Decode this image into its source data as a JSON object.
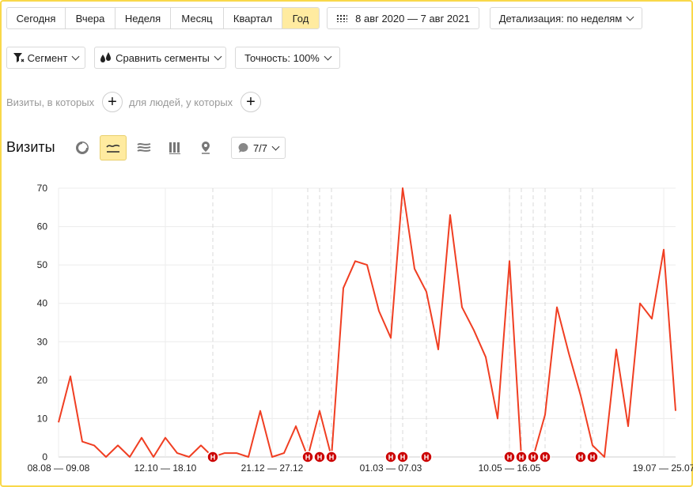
{
  "period_tabs": [
    {
      "label": "Сегодня",
      "active": false
    },
    {
      "label": "Вчера",
      "active": false
    },
    {
      "label": "Неделя",
      "active": false
    },
    {
      "label": "Месяц",
      "active": false
    },
    {
      "label": "Квартал",
      "active": false
    },
    {
      "label": "Год",
      "active": true
    }
  ],
  "date_range": "8 авг 2020 — 7 авг 2021",
  "detail_label": "Детализация: по неделям",
  "segment_label": "Сегмент",
  "compare_label": "Сравнить сегменты",
  "accuracy_label": "Точность: 100%",
  "filter": {
    "visits_label": "Визиты, в которых",
    "people_label": "для людей, у которых"
  },
  "chart_title": "Визиты",
  "annotations_label": "7/7",
  "colors": {
    "accent": "#ffeba0",
    "line": "#f03e22",
    "marker": "#cc0000",
    "frame": "#f9d84a"
  },
  "chart_data": {
    "type": "line",
    "ylim": [
      0,
      70
    ],
    "yticks": [
      0,
      10,
      20,
      30,
      40,
      50,
      60,
      70
    ],
    "xtick_labels": [
      "08.08 — 09.08",
      "12.10 — 18.10",
      "21.12 — 27.12",
      "01.03 — 07.03",
      "10.05 — 16.05",
      "19.07 — 25.07"
    ],
    "series": [
      {
        "values": [
          9,
          21,
          4,
          3,
          0,
          3,
          0,
          5,
          0,
          5,
          1,
          0,
          3,
          0,
          1,
          1,
          0,
          12,
          0,
          1,
          8,
          0,
          12,
          0,
          44,
          51,
          50,
          38,
          31,
          70,
          49,
          43,
          28,
          63,
          39,
          33,
          26,
          10,
          51,
          0,
          0,
          11,
          39,
          27,
          16,
          3,
          0,
          28,
          8,
          40,
          36,
          54,
          12
        ]
      }
    ],
    "annotation_marker_label": "Н",
    "annotation_week_indices": [
      13,
      21,
      22,
      23,
      28,
      29,
      31,
      38,
      39,
      40,
      41,
      44,
      45
    ]
  }
}
